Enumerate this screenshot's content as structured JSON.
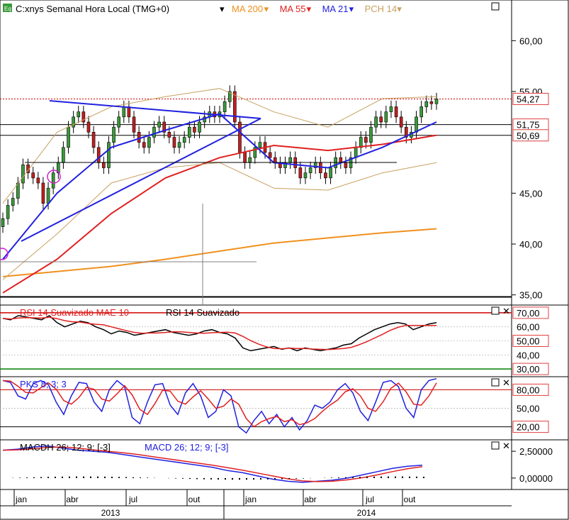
{
  "header": {
    "badge": "Eq",
    "title": "C:xnys Semanal Hora Local (TMG+0)",
    "studies": [
      "MA 200",
      "MA 55",
      "MA 21",
      "PCH 14"
    ],
    "study_colors": [
      "#f0901e",
      "#e02020",
      "#2020e0",
      "#c8a060"
    ]
  },
  "panels": {
    "rsi": {
      "labels": [
        "RSI 14 Suavizado MAE 10",
        "RSI 14 Suavizado"
      ],
      "levels": [
        "70,00",
        "60,00",
        "50,00",
        "40,00",
        "30,00"
      ]
    },
    "pks": {
      "label": "PKS 8; 3; 3",
      "levels": [
        "80,00",
        "50,00",
        "20,00"
      ]
    },
    "macd": {
      "labels": [
        "MACDH 26; 12; 9; [-3]",
        "MACD 26; 12; 9; [-3]"
      ],
      "levels": [
        "2,50000",
        "0,00000"
      ]
    }
  },
  "price_axis": {
    "ticks": [
      "60,00",
      "55,00",
      "45,00",
      "40,00",
      "35,00"
    ],
    "tags": [
      "54,27",
      "51,75",
      "50,69"
    ]
  },
  "time_axis": {
    "months": [
      "jan",
      "abr",
      "jul",
      "out",
      "jan",
      "abr",
      "jul",
      "out"
    ],
    "years": [
      "2013",
      "2014"
    ]
  },
  "chart_data": {
    "type": "candlestick",
    "title": "C:xnys Semanal Hora Local (TMG+0)",
    "x_range": [
      "2012-12",
      "2014-11"
    ],
    "y_range": [
      34,
      64
    ],
    "last_price": 54.27,
    "levels": [
      51.75,
      50.69
    ],
    "close_series_approx": [
      42.5,
      43.8,
      44.5,
      46.0,
      47.8,
      47.0,
      46.5,
      46.0,
      44.0,
      45.5,
      47.0,
      48.0,
      49.5,
      51.5,
      52.5,
      53.0,
      52.0,
      51.0,
      49.5,
      48.0,
      47.5,
      50.0,
      51.5,
      52.5,
      53.5,
      52.5,
      51.0,
      50.0,
      49.5,
      50.5,
      51.5,
      52.0,
      51.0,
      50.5,
      49.5,
      50.0,
      50.5,
      51.5,
      51.0,
      52.0,
      52.5,
      53.0,
      52.5,
      53.0,
      54.0,
      55.0,
      52.0,
      49.0,
      48.0,
      48.5,
      49.5,
      50.0,
      49.0,
      48.5,
      48.0,
      47.5,
      48.0,
      48.5,
      47.5,
      46.5,
      47.0,
      47.5,
      48.0,
      47.0,
      46.5,
      47.5,
      48.5,
      48.0,
      47.5,
      48.5,
      49.5,
      50.5,
      50.0,
      51.5,
      52.5,
      52.0,
      53.0,
      53.5,
      52.5,
      51.5,
      50.5,
      51.0,
      52.5,
      53.5,
      54.0,
      53.8,
      54.27
    ],
    "series": [
      {
        "name": "MA 200",
        "values": [
          36.8,
          37.3,
          37.8,
          38.5,
          39.3,
          40.1,
          40.6,
          41.1,
          41.5
        ]
      },
      {
        "name": "MA 55",
        "values": [
          35.2,
          38.5,
          43.0,
          46.5,
          48.5,
          49.7,
          49.2,
          49.8,
          50.7
        ]
      },
      {
        "name": "MA 21",
        "values": [
          38.5,
          45.0,
          49.5,
          51.2,
          52.8,
          48.0,
          47.5,
          49.5,
          52.0
        ]
      },
      {
        "name": "PCH 14 high",
        "values": [
          44.0,
          51.0,
          53.5,
          54.5,
          55.3,
          53.0,
          51.5,
          54.3,
          54.5
        ]
      },
      {
        "name": "PCH 14 low",
        "values": [
          36.5,
          41.0,
          46.0,
          47.5,
          48.0,
          45.5,
          45.3,
          47.0,
          48.0
        ]
      }
    ],
    "rsi_range": [
      25,
      75
    ],
    "pks_range": [
      0,
      100
    ],
    "macd_range": [
      -1.0,
      3.5
    ]
  }
}
